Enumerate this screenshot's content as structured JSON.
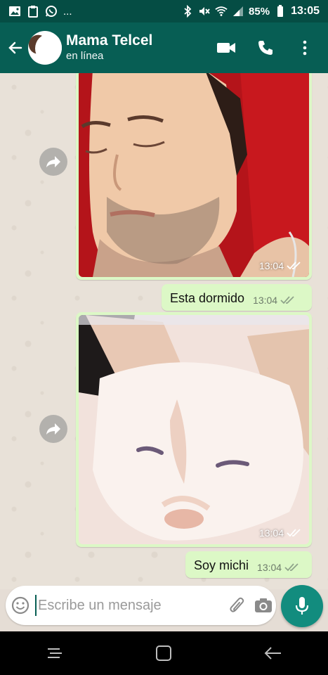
{
  "statusbar": {
    "battery": "85%",
    "time": "13:05",
    "dots": "..."
  },
  "header": {
    "contact_name": "Mama Telcel",
    "status": "en línea"
  },
  "messages": [
    {
      "type": "image",
      "subject": "sleeping man",
      "time": "13:04"
    },
    {
      "type": "text",
      "text": "Esta dormido",
      "time": "13:04"
    },
    {
      "type": "image",
      "subject": "white cat",
      "time": "13:04"
    },
    {
      "type": "text",
      "text": "Soy michi",
      "time": "13:04"
    }
  ],
  "composer": {
    "placeholder": "Escribe un mensaje"
  },
  "colors": {
    "header": "#075e54",
    "outgoing_bubble": "#dcf8c6",
    "accent": "#128c7e"
  }
}
